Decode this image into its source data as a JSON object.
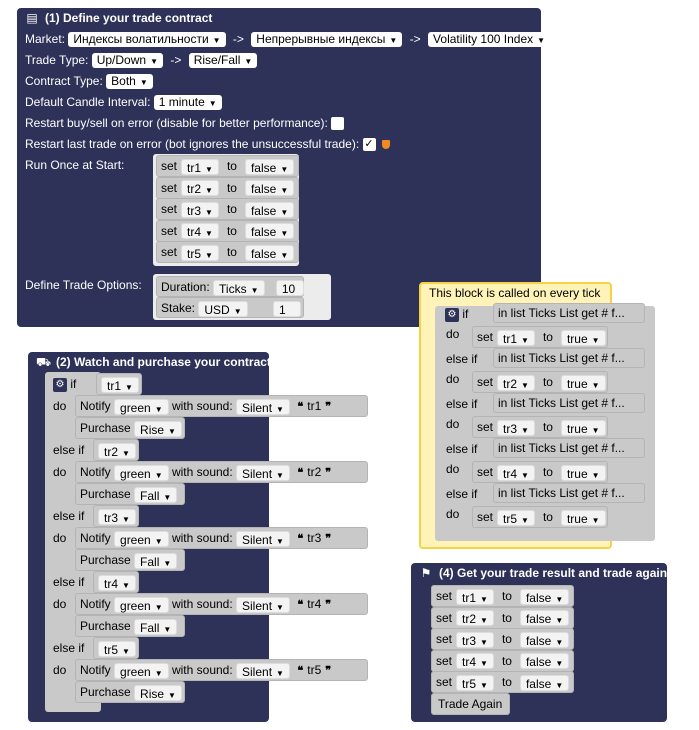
{
  "block1": {
    "title": "(1) Define your trade contract",
    "icon": "document-icon",
    "market_label": "Market:",
    "market": "Индексы волатильности",
    "submarket": "Непрерывные индексы",
    "symbol": "Volatility 100 Index",
    "trade_type_label": "Trade Type:",
    "trade_type": "Up/Down",
    "trade_subtype": "Rise/Fall",
    "contract_type_label": "Contract Type:",
    "contract_type": "Both",
    "candle_label": "Default Candle Interval:",
    "candle": "1 minute",
    "restart_label": "Restart buy/sell on error  (disable for better performance):",
    "restart_last_label": "Restart last trade on error  (bot ignores the unsuccessful trade):",
    "run_once_label": "Run Once at Start:",
    "sets": [
      {
        "var": "tr1",
        "val": "false"
      },
      {
        "var": "tr2",
        "val": "false"
      },
      {
        "var": "tr3",
        "val": "false"
      },
      {
        "var": "tr4",
        "val": "false"
      },
      {
        "var": "tr5",
        "val": "false"
      }
    ],
    "options_label": "Define Trade Options:",
    "duration_label": "Duration:",
    "duration_unit": "Ticks",
    "duration_value": "10",
    "stake_label": "Stake:",
    "stake_currency": "USD",
    "stake_value": "1"
  },
  "words": {
    "set": "set",
    "to": "to",
    "if": "if",
    "do": "do",
    "else_if": "else if",
    "notify": "Notify",
    "with_sound": "with sound:",
    "purchase": "Purchase",
    "in_list": "in list",
    "ticks_list": "Ticks List",
    "get": "get",
    "hash_f": "# f...",
    "open_quote": "❝",
    "close_quote": "❞",
    "arrow": "->"
  },
  "tick_block": {
    "title": "This block is called on every tick",
    "rows": [
      {
        "kw": "if",
        "var": "tr1",
        "val": "true"
      },
      {
        "kw": "else if",
        "var": "tr2",
        "val": "true"
      },
      {
        "kw": "else if",
        "var": "tr3",
        "val": "true"
      },
      {
        "kw": "else if",
        "var": "tr4",
        "val": "true"
      },
      {
        "kw": "else if",
        "var": "tr5",
        "val": "true"
      }
    ]
  },
  "block2": {
    "title": "(2) Watch and purchase your contract",
    "icon": "cart-icon",
    "rows": [
      {
        "kw": "if",
        "cond": "tr1",
        "color": "green",
        "sound": "Silent",
        "msg": "tr1",
        "dir": "Rise"
      },
      {
        "kw": "else if",
        "cond": "tr2",
        "color": "green",
        "sound": "Silent",
        "msg": "tr2",
        "dir": "Fall"
      },
      {
        "kw": "else if",
        "cond": "tr3",
        "color": "green",
        "sound": "Silent",
        "msg": "tr3",
        "dir": "Fall"
      },
      {
        "kw": "else if",
        "cond": "tr4",
        "color": "green",
        "sound": "Silent",
        "msg": "tr4",
        "dir": "Fall"
      },
      {
        "kw": "else if",
        "cond": "tr5",
        "color": "green",
        "sound": "Silent",
        "msg": "tr5",
        "dir": "Rise"
      }
    ]
  },
  "block4": {
    "title": "(4) Get your trade result and trade again",
    "icon": "flag-icon",
    "sets": [
      {
        "var": "tr1",
        "val": "false"
      },
      {
        "var": "tr2",
        "val": "false"
      },
      {
        "var": "tr3",
        "val": "false"
      },
      {
        "var": "tr4",
        "val": "false"
      },
      {
        "var": "tr5",
        "val": "false"
      }
    ],
    "trade_again": "Trade Again"
  }
}
